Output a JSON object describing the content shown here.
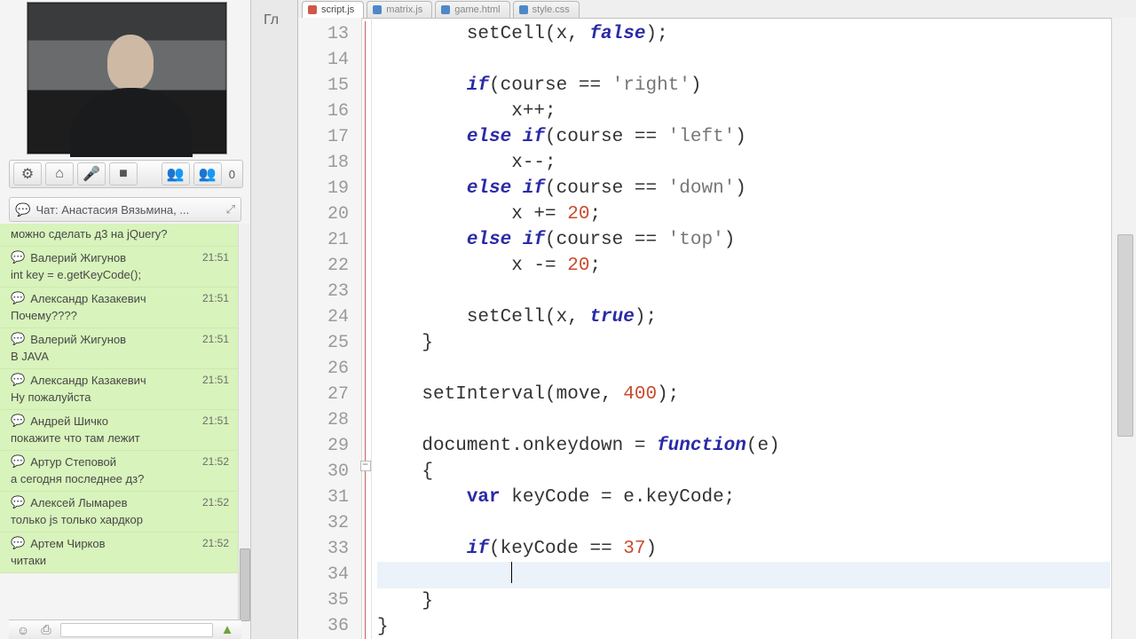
{
  "mid_crumb": "Гл",
  "video_toolbar": {
    "count": "0"
  },
  "chat": {
    "title": "Чат: Анастасия Вязьмина, ...",
    "messages": [
      {
        "name": "",
        "time": "",
        "body": "можно сделать д3 на jQuery?",
        "truncated": true
      },
      {
        "name": "Валерий Жигунов",
        "time": "21:51",
        "body": "int key = e.getKeyCode();"
      },
      {
        "name": "Александр Казакевич",
        "time": "21:51",
        "body": "Почему????"
      },
      {
        "name": "Валерий Жигунов",
        "time": "21:51",
        "body": "В JAVA"
      },
      {
        "name": "Александр Казакевич",
        "time": "21:51",
        "body": "Ну пожалуйста"
      },
      {
        "name": "Андрей Шичко",
        "time": "21:51",
        "body": "покажите что там лежит"
      },
      {
        "name": "Артур Степовой",
        "time": "21:52",
        "body": "а сегодня последнее дз?"
      },
      {
        "name": "Алексей Лымарев",
        "time": "21:52",
        "body": "только js только хардкор"
      },
      {
        "name": "Артем Чирков",
        "time": "21:52",
        "body": "читаки"
      }
    ]
  },
  "editor": {
    "tabs": [
      {
        "label": "script.js",
        "color": "r",
        "active": true
      },
      {
        "label": "matrix.js",
        "color": "b",
        "active": false
      },
      {
        "label": "game.html",
        "color": "b",
        "active": false
      },
      {
        "label": "style.css",
        "color": "b",
        "active": false
      }
    ],
    "first_line": 13,
    "last_line": 36,
    "lines": [
      {
        "t": "        setCell(x, ",
        "a": "false",
        "b": ");"
      },
      {
        "t": ""
      },
      {
        "kw": "if",
        "t2": "(course == ",
        "s": "'right'",
        "t3": ")"
      },
      {
        "t": "            x++;"
      },
      {
        "kw": "else if",
        "t2": "(course == ",
        "s": "'left'",
        "t3": ")"
      },
      {
        "t": "            x--;"
      },
      {
        "kw": "else if",
        "t2": "(course == ",
        "s": "'down'",
        "t3": ")"
      },
      {
        "t": "            x += ",
        "n": "20",
        "t3": ";"
      },
      {
        "kw": "else if",
        "t2": "(course == ",
        "s": "'top'",
        "t3": ")"
      },
      {
        "t": "            x -= ",
        "n": "20",
        "t3": ";"
      },
      {
        "t": ""
      },
      {
        "t": "        setCell(x, ",
        "a": "true",
        "b": ");"
      },
      {
        "t": "    }"
      },
      {
        "t": ""
      },
      {
        "t": "    setInterval(move, ",
        "n": "400",
        "t3": ");"
      },
      {
        "t": ""
      },
      {
        "t": "    document.onkeydown = ",
        "fn": "function",
        "t3": "(e)"
      },
      {
        "t": "    {"
      },
      {
        "kw2": "var",
        "t2": " keyCode = e.keyCode;"
      },
      {
        "t": ""
      },
      {
        "kw": "if",
        "t2": "(keyCode == ",
        "n": "37",
        "t3": ")"
      },
      {
        "t": "",
        "cursor": true
      },
      {
        "t": "    }"
      },
      {
        "t": "}"
      }
    ]
  }
}
